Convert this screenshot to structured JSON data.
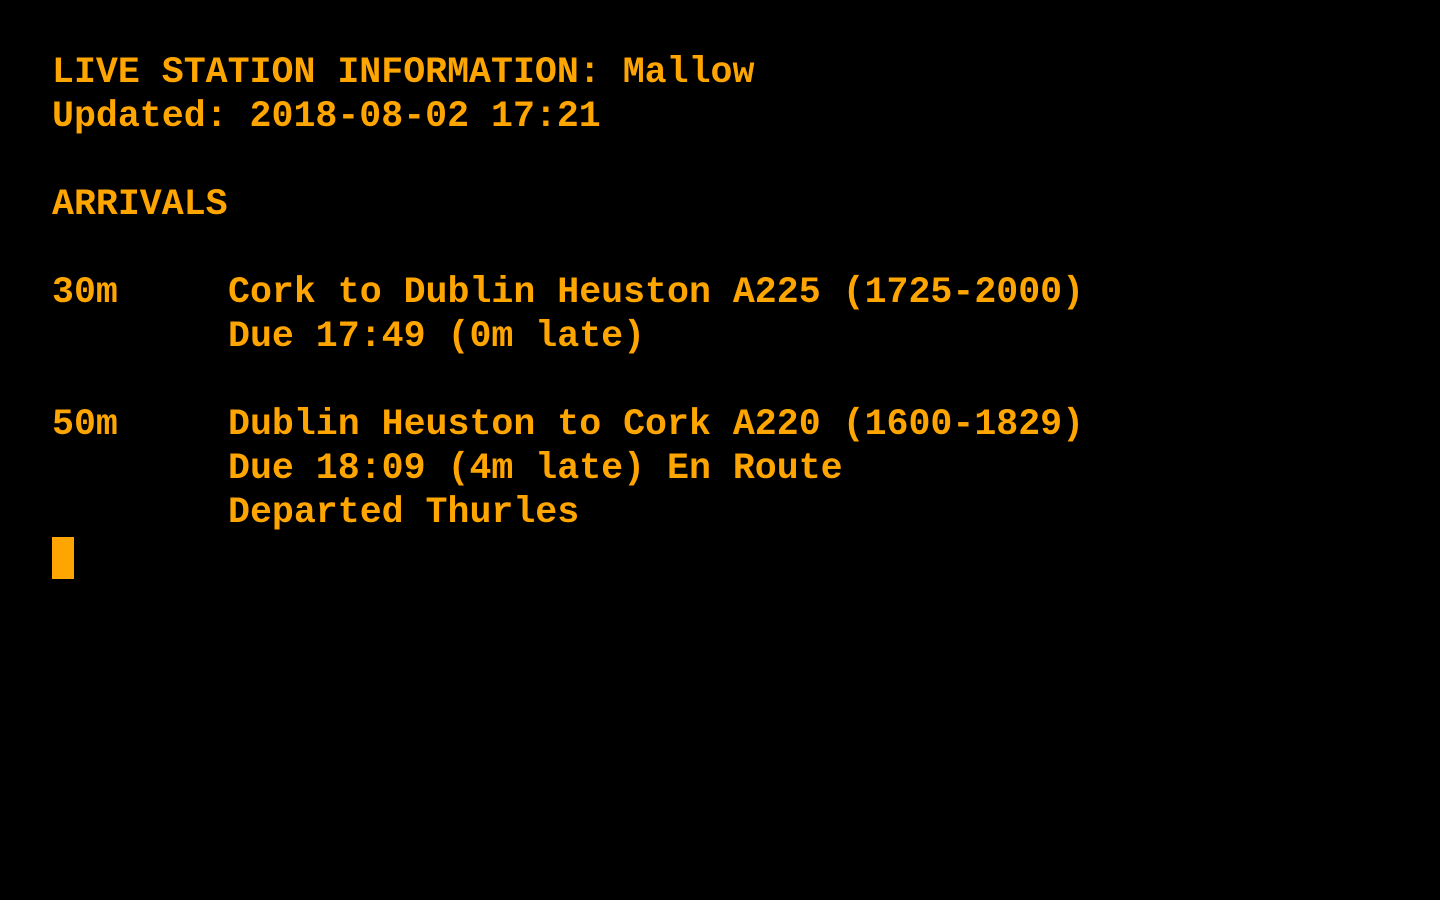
{
  "colors": {
    "background": "#000000",
    "text": "#FFA500"
  },
  "header": {
    "title": "LIVE STATION INFORMATION: Mallow",
    "updated": "Updated: 2018-08-02 17:21"
  },
  "section": {
    "label": "ARRIVALS"
  },
  "arrivals": [
    {
      "minutes": "30m",
      "route": "Cork to Dublin Heuston A225 (1725-2000)",
      "due": "Due 17:49 (0m late)"
    },
    {
      "minutes": "50m",
      "route": "Dublin Heuston to Cork A220 (1600-1829)",
      "due": "Due 18:09 (4m late) En Route",
      "status": "Departed Thurles"
    }
  ]
}
